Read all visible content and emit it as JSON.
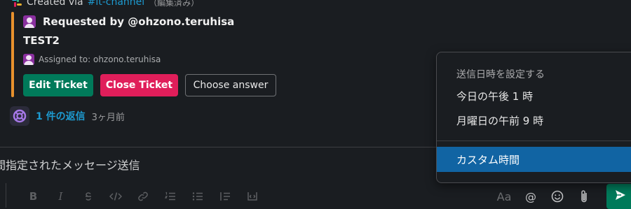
{
  "message": {
    "created_prefix": "Created via",
    "channel": "#it-channel",
    "edited_label": "（編集済み）"
  },
  "attachment": {
    "accent_color": "#e8912d",
    "requested_by": "Requested by @ohzono.teruhisa",
    "title": "TEST2",
    "assigned": "Assigned to: ohzono.teruhisa",
    "buttons": {
      "edit": "Edit Ticket",
      "close": "Close Ticket",
      "choose": "Choose answer"
    }
  },
  "thread": {
    "replies": "1 件の返信",
    "time": "3ヶ月前",
    "icon": "lifebuoy-icon"
  },
  "composer": {
    "text": "間指定されたメッセージ送信",
    "format_icons": [
      "bold-icon",
      "italic-icon",
      "strikethrough-icon",
      "code-icon",
      "link-icon",
      "ordered-list-icon",
      "bulleted-list-icon",
      "blockquote-icon",
      "code-block-icon"
    ],
    "format_labels": {
      "bold": "B",
      "italic": "I"
    },
    "right_tools": {
      "text_format": "Aa",
      "mention": "@"
    }
  },
  "schedule_menu": {
    "header": "送信日時を設定する",
    "items": [
      "今日の午後 1 時",
      "月曜日の午前 9 時"
    ],
    "custom": "カスタム時間",
    "highlight_color": "#1164a3"
  },
  "colors": {
    "edit_button": "#007a5a",
    "close_button": "#e01e5a",
    "link": "#1d9bd1",
    "send_button": "#007a5a"
  }
}
